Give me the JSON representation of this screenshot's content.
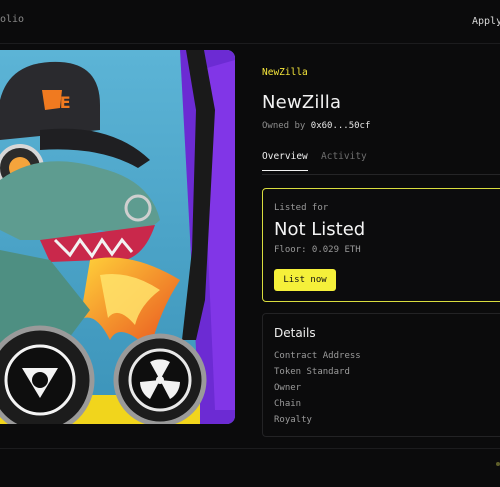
{
  "header": {
    "crumb": "olio",
    "apply": "Apply"
  },
  "nft": {
    "collection": "NewZilla",
    "name": "NewZilla",
    "owned_prefix": "Owned by",
    "owner_address": "0x60...50cf",
    "art_icons": [
      "cap-icon",
      "gas-mask-icon",
      "radiation-icon"
    ],
    "cap_text": "CE"
  },
  "tabs": [
    {
      "label": "Overview",
      "active": true
    },
    {
      "label": "Activity",
      "active": false
    }
  ],
  "listing": {
    "label": "Listed for",
    "status": "Not Listed",
    "floor": "Floor: 0.029 ETH",
    "button": "List now"
  },
  "details": {
    "heading": "Details",
    "rows": [
      "Contract Address",
      "Token Standard",
      "Owner",
      "Chain",
      "Royalty"
    ]
  },
  "colors": {
    "accent": "#f5f03a",
    "background": "#0b0b0c",
    "border_highlight": "#d9dd3e"
  }
}
